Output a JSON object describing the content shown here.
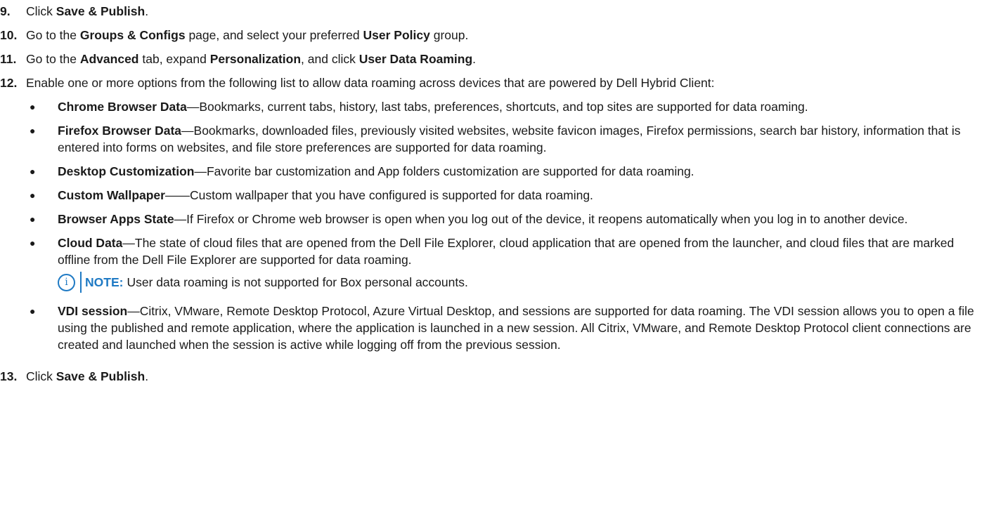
{
  "colors": {
    "text": "#1a1a1a",
    "note_accent": "#1f7ac4"
  },
  "steps": [
    {
      "num": "9.",
      "t1": "Click ",
      "b1": "Save & Publish",
      "t2": "."
    },
    {
      "num": "10.",
      "t1": "Go to the ",
      "b1": "Groups & Configs",
      "t2": " page, and select your preferred ",
      "b2": "User Policy",
      "t3": " group."
    },
    {
      "num": "11.",
      "t1": "Go to the ",
      "b1": "Advanced",
      "t2": " tab, expand ",
      "b2": "Personalization",
      "t3": ", and click ",
      "b3": "User Data Roaming",
      "t4": "."
    },
    {
      "num": "12.",
      "text": "Enable one or more options from the following list to allow data roaming across devices that are powered by Dell Hybrid Client:",
      "bullets": [
        {
          "term": "Chrome Browser Data",
          "desc": "—Bookmarks, current tabs, history, last tabs, preferences, shortcuts, and top sites are supported for data roaming."
        },
        {
          "term": "Firefox Browser Data",
          "desc": "—Bookmarks, downloaded files, previously visited websites, website favicon images, Firefox permissions, search bar history, information that is entered into forms on websites, and file store preferences are supported for data roaming."
        },
        {
          "term": "Desktop Customization",
          "desc": "—Favorite bar customization and App folders customization are supported for data roaming."
        },
        {
          "term": "Custom Wallpaper",
          "desc": "——Custom wallpaper that you have configured is supported for data roaming."
        },
        {
          "term": "Browser Apps State",
          "desc": "—If Firefox or Chrome web browser is open when you log out of the device, it reopens automatically when you log in to another device."
        },
        {
          "term": "Cloud Data",
          "desc": "—The state of cloud files that are opened from the Dell File Explorer, cloud application that are opened from the launcher, and cloud files that are marked offline from the Dell File Explorer are supported for data roaming."
        },
        {
          "term": "VDI session",
          "desc": "—Citrix, VMware, Remote Desktop Protocol, Azure Virtual Desktop, and sessions are supported for data roaming. The VDI session allows you to open a file using the published and remote application, where the application is launched in a new session. All Citrix, VMware, and Remote Desktop Protocol client connections are created and launched when the session is active while logging off from the previous session."
        }
      ],
      "note": {
        "icon": "i",
        "label": "NOTE:",
        "text": "User data roaming is not supported for Box personal accounts."
      }
    },
    {
      "num": "13.",
      "t1": "Click ",
      "b1": "Save & Publish",
      "t2": "."
    }
  ]
}
